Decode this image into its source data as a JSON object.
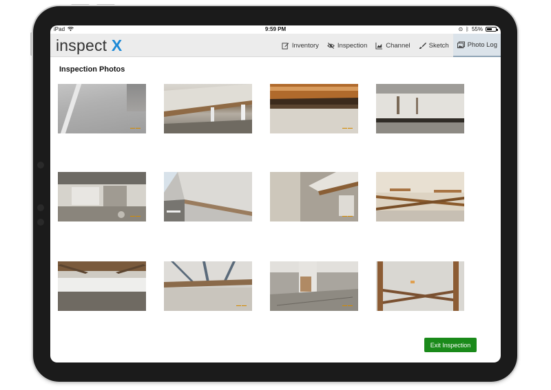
{
  "status_bar": {
    "device": "iPad",
    "time": "9:59 PM",
    "battery": "55%",
    "battery_level": 0.55
  },
  "app": {
    "logo_text": "inspect",
    "logo_accent": "X",
    "accent_color": "#1d8ad6"
  },
  "nav": {
    "items": [
      {
        "label": "Inventory",
        "icon": "edit-icon"
      },
      {
        "label": "Inspection",
        "icon": "eye-off-icon"
      },
      {
        "label": "Channel",
        "icon": "chart-icon"
      },
      {
        "label": "Sketch",
        "icon": "brush-icon"
      },
      {
        "label": "Photo Log",
        "icon": "photos-icon",
        "active": true
      }
    ]
  },
  "page": {
    "title": "Inspection Photos"
  },
  "photos": [
    {
      "subject": "bridge deck road surface"
    },
    {
      "subject": "girder underside with rust"
    },
    {
      "subject": "bearing rust detail"
    },
    {
      "subject": "concrete beam end"
    },
    {
      "subject": "spalled abutment"
    },
    {
      "subject": "girder fascia with highway"
    },
    {
      "subject": "pier and girder rust"
    },
    {
      "subject": "cross frames underside"
    },
    {
      "subject": "underside with cross frames and wall"
    },
    {
      "subject": "deck underside framing"
    },
    {
      "subject": "pier column base"
    },
    {
      "subject": "rusted cross bracing"
    }
  ],
  "actions": {
    "exit_label": "Exit Inspection",
    "exit_color": "#1a8a1a"
  }
}
